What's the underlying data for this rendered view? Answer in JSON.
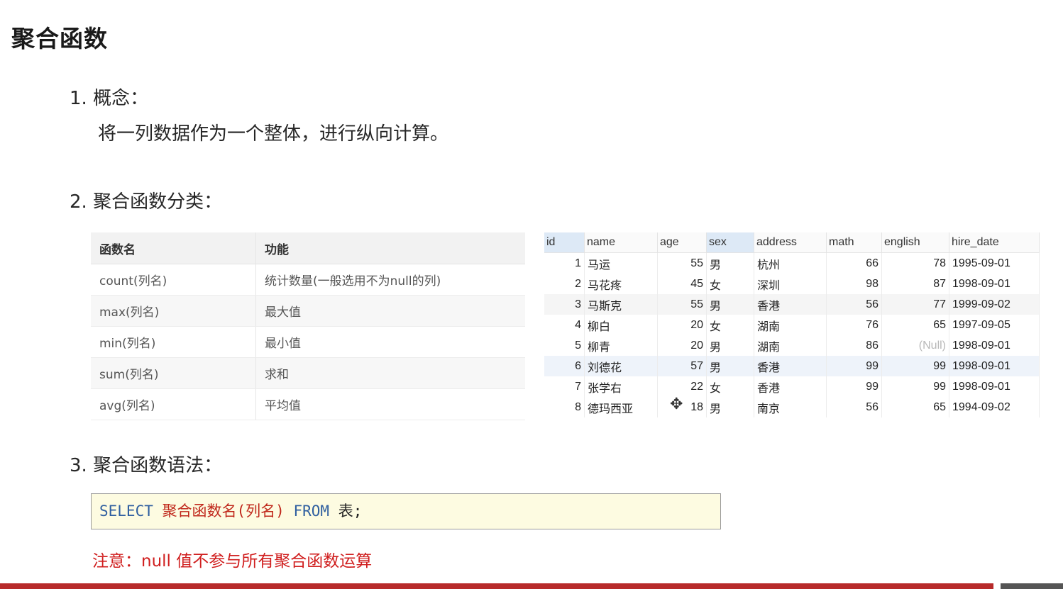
{
  "title": "聚合函数",
  "sections": {
    "concept_heading": "1.  概念：",
    "concept_body": "将一列数据作为一个整体，进行纵向计算。",
    "classify_heading": "2. 聚合函数分类：",
    "syntax_heading": "3. 聚合函数语法："
  },
  "func_table": {
    "headers": [
      "函数名",
      "功能"
    ],
    "rows": [
      [
        "count(列名)",
        "统计数量(一般选用不为null的列)"
      ],
      [
        "max(列名)",
        "最大值"
      ],
      [
        "min(列名)",
        "最小值"
      ],
      [
        "sum(列名)",
        "求和"
      ],
      [
        "avg(列名)",
        "平均值"
      ]
    ]
  },
  "data_grid": {
    "headers": [
      "id",
      "name",
      "age",
      "sex",
      "address",
      "math",
      "english",
      "hire_date"
    ],
    "rows": [
      [
        "1",
        "马运",
        "55",
        "男",
        "杭州",
        "66",
        "78",
        "1995-09-01"
      ],
      [
        "2",
        "马花疼",
        "45",
        "女",
        "深圳",
        "98",
        "87",
        "1998-09-01"
      ],
      [
        "3",
        "马斯克",
        "55",
        "男",
        "香港",
        "56",
        "77",
        "1999-09-02"
      ],
      [
        "4",
        "柳白",
        "20",
        "女",
        "湖南",
        "76",
        "65",
        "1997-09-05"
      ],
      [
        "5",
        "柳青",
        "20",
        "男",
        "湖南",
        "86",
        "(Null)",
        "1998-09-01"
      ],
      [
        "6",
        "刘德花",
        "57",
        "男",
        "香港",
        "99",
        "99",
        "1998-09-01"
      ],
      [
        "7",
        "张学右",
        "22",
        "女",
        "香港",
        "99",
        "99",
        "1998-09-01"
      ],
      [
        "8",
        "德玛西亚",
        "18",
        "男",
        "南京",
        "56",
        "65",
        "1994-09-02"
      ]
    ]
  },
  "syntax": {
    "select": "SELECT",
    "func": "聚合函数名(列名)",
    "from": "FROM",
    "rest": "表;"
  },
  "note": "注意：null 值不参与所有聚合函数运算",
  "cursor_icon": "move-cursor-icon"
}
